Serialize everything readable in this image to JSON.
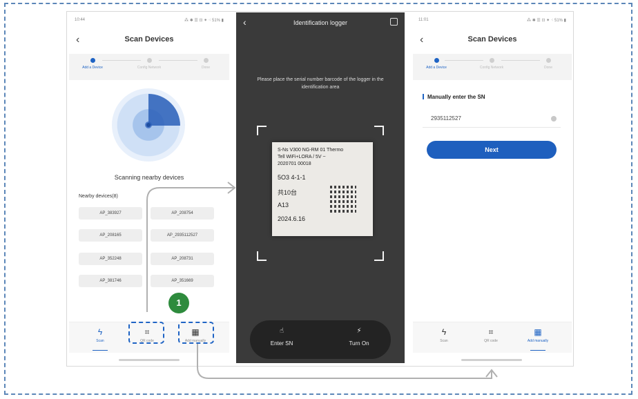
{
  "screen1": {
    "status_left": "10:44",
    "status_right": "⁂ ✱ ☰ ⊡ ⁕ ⁖ 51% ▮",
    "title": "Scan Devices",
    "steps": [
      "Add a Device",
      "Config Network",
      "Done"
    ],
    "scanning_text": "Scanning nearby devices",
    "nearby_label": "Nearby devices(8)",
    "devices": [
      "AP_383927",
      "AP_208754",
      "AP_208165",
      "AP_2935112527",
      "AP_352248",
      "AP_208731",
      "AP_381746",
      "AP_351669"
    ],
    "tabs": [
      "Scan",
      "QR code",
      "Add manually"
    ],
    "tab_icons": [
      "bolt-icon",
      "qr-scan-icon",
      "grid-icon"
    ],
    "badge": "1"
  },
  "screen2": {
    "title": "Identification logger",
    "hint": "Please place the serial number barcode of the logger in the identification area",
    "label_lines": [
      "S-Ns V300 NG-RM 01 Thermo",
      "Tell WiFi+LORA / 5V ~",
      "2020701 00018",
      "5O3 4-1-1",
      "共10台",
      "A13",
      "2024.6.16"
    ],
    "buttons": [
      "Enter SN",
      "Turn On"
    ]
  },
  "screen3": {
    "status_left": "11:01",
    "status_right": "⁂ ✱ ☰ ⊡ ⁕ ⁖ 51% ▮",
    "title": "Scan Devices",
    "steps": [
      "Add a Device",
      "Config Network",
      "Done"
    ],
    "section_title": "Manually enter the SN",
    "sn_value": "2935112527",
    "next_label": "Next",
    "tabs": [
      "Scan",
      "QR code",
      "Add manually"
    ]
  },
  "colors": {
    "accent": "#1e63c4",
    "badge": "#2e8b3d",
    "frame": "#5b86b8"
  }
}
